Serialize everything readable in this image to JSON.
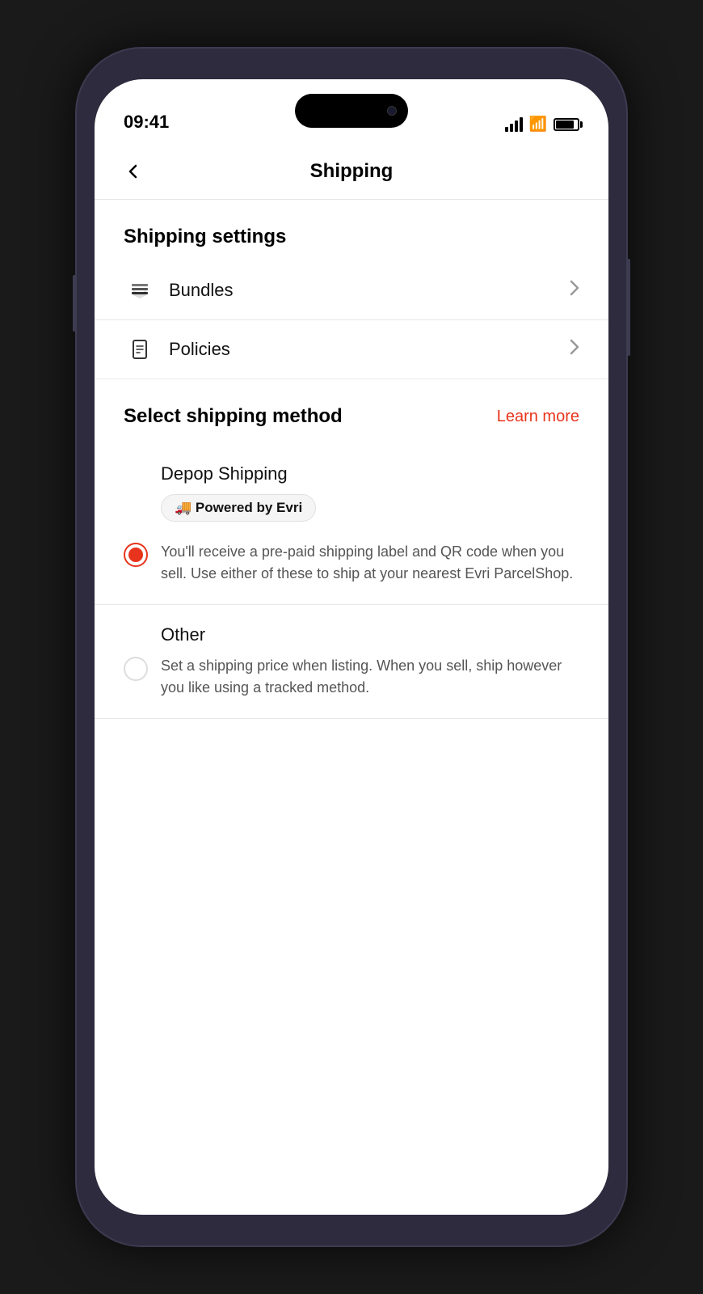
{
  "statusBar": {
    "time": "09:41",
    "signal": "full",
    "wifi": true,
    "battery": 85
  },
  "header": {
    "title": "Shipping",
    "backLabel": "←"
  },
  "shippingSettings": {
    "sectionTitle": "Shipping settings",
    "items": [
      {
        "id": "bundles",
        "label": "Bundles",
        "icon": "bundles-icon"
      },
      {
        "id": "policies",
        "label": "Policies",
        "icon": "policies-icon"
      }
    ]
  },
  "shippingMethod": {
    "sectionTitle": "Select shipping method",
    "learnMore": "Learn more",
    "options": [
      {
        "id": "depop-shipping",
        "name": "Depop Shipping",
        "badge": "🚚 Powered by Evri",
        "description": "You'll receive a pre-paid shipping label and QR code when you sell. Use either of these to ship at your nearest Evri ParcelShop.",
        "selected": true
      },
      {
        "id": "other-shipping",
        "name": "Other",
        "badge": null,
        "description": "Set a shipping price when listing. When you sell, ship however you like using a tracked method.",
        "selected": false
      }
    ]
  }
}
